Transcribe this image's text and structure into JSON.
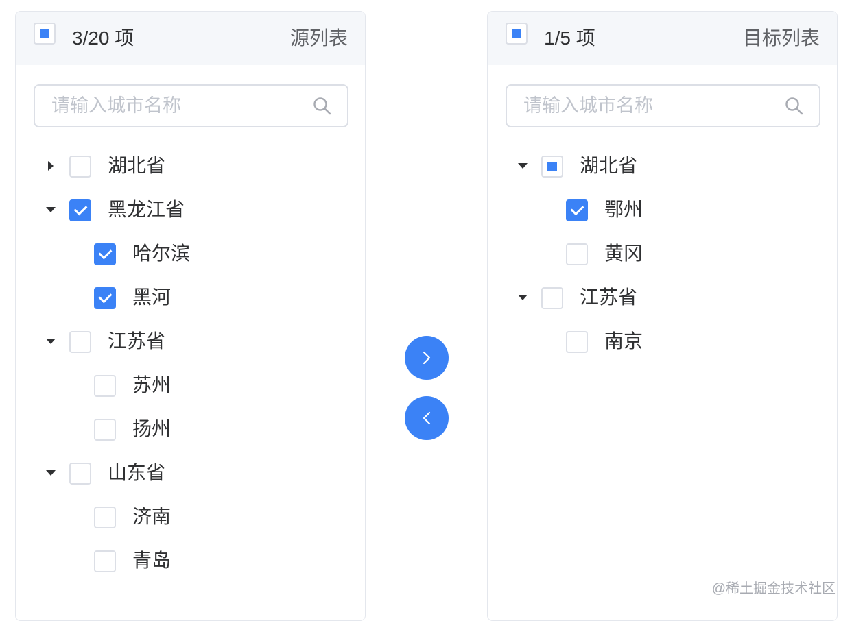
{
  "source": {
    "count_label": "3/20 项",
    "title": "源列表",
    "header_check_state": "indeterminate",
    "search_placeholder": "请输入城市名称",
    "tree": [
      {
        "label": "湖北省",
        "level": 0,
        "arrow": "collapsed",
        "state": "unchecked"
      },
      {
        "label": "黑龙江省",
        "level": 0,
        "arrow": "expanded",
        "state": "checked"
      },
      {
        "label": "哈尔滨",
        "level": 1,
        "state": "checked"
      },
      {
        "label": "黑河",
        "level": 1,
        "state": "checked"
      },
      {
        "label": "江苏省",
        "level": 0,
        "arrow": "expanded",
        "state": "unchecked"
      },
      {
        "label": "苏州",
        "level": 1,
        "state": "unchecked"
      },
      {
        "label": "扬州",
        "level": 1,
        "state": "unchecked"
      },
      {
        "label": "山东省",
        "level": 0,
        "arrow": "expanded",
        "state": "unchecked"
      },
      {
        "label": "济南",
        "level": 1,
        "state": "unchecked"
      },
      {
        "label": "青岛",
        "level": 1,
        "state": "unchecked"
      }
    ]
  },
  "target": {
    "count_label": "1/5 项",
    "title": "目标列表",
    "header_check_state": "indeterminate",
    "search_placeholder": "请输入城市名称",
    "tree": [
      {
        "label": "湖北省",
        "level": 0,
        "arrow": "expanded",
        "state": "indeterminate"
      },
      {
        "label": "鄂州",
        "level": 1,
        "state": "checked"
      },
      {
        "label": "黄冈",
        "level": 1,
        "state": "unchecked"
      },
      {
        "label": "江苏省",
        "level": 0,
        "arrow": "expanded",
        "state": "unchecked"
      },
      {
        "label": "南京",
        "level": 1,
        "state": "unchecked"
      }
    ]
  },
  "buttons": {
    "to_target_icon": "chevron-right-icon",
    "to_source_icon": "chevron-left-icon"
  },
  "colors": {
    "accent": "#3b82f6",
    "header_bg": "#f5f7fa",
    "border": "#dcdfe6",
    "text": "#303133",
    "placeholder": "#c0c4cc"
  },
  "watermark": "@稀土掘金技术社区"
}
